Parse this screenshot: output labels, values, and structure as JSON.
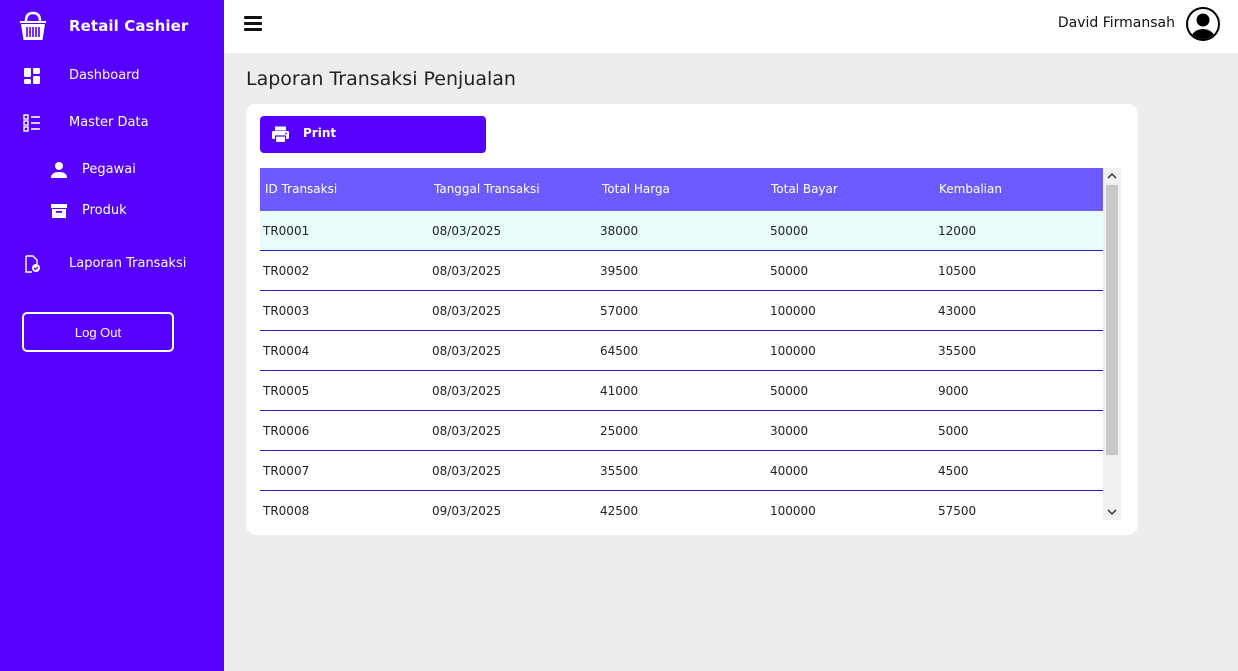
{
  "app": {
    "title": "Retail Cashier"
  },
  "sidebar": {
    "items": [
      {
        "label": "Dashboard",
        "icon": "dashboard-icon"
      },
      {
        "label": "Master Data",
        "icon": "list-icon"
      },
      {
        "label": "Pegawai",
        "icon": "person-icon"
      },
      {
        "label": "Produk",
        "icon": "archive-icon"
      },
      {
        "label": "Laporan Transaksi",
        "icon": "report-icon"
      }
    ],
    "logout_label": "Log Out"
  },
  "topbar": {
    "username": "David Firmansah"
  },
  "main": {
    "title": "Laporan Transaksi Penjualan",
    "print_label": "Print"
  },
  "table": {
    "columns": [
      "ID Transaksi",
      "Tanggal Transaksi",
      "Total Harga",
      "Total Bayar",
      "Kembalian"
    ],
    "rows": [
      [
        "TR0001",
        "08/03/2025",
        "38000",
        "50000",
        "12000"
      ],
      [
        "TR0002",
        "08/03/2025",
        "39500",
        "50000",
        "10500"
      ],
      [
        "TR0003",
        "08/03/2025",
        "57000",
        "100000",
        "43000"
      ],
      [
        "TR0004",
        "08/03/2025",
        "64500",
        "100000",
        "35500"
      ],
      [
        "TR0005",
        "08/03/2025",
        "41000",
        "50000",
        "9000"
      ],
      [
        "TR0006",
        "08/03/2025",
        "25000",
        "30000",
        "5000"
      ],
      [
        "TR0007",
        "08/03/2025",
        "35500",
        "40000",
        "4500"
      ],
      [
        "TR0008",
        "09/03/2025",
        "42500",
        "100000",
        "57500"
      ]
    ]
  },
  "colors": {
    "sidebar": "#5600ff",
    "table_header": "#6c5cff",
    "selected_row": "#e9fdfd",
    "row_divider": "#2b1dc8",
    "background": "#ededed"
  }
}
